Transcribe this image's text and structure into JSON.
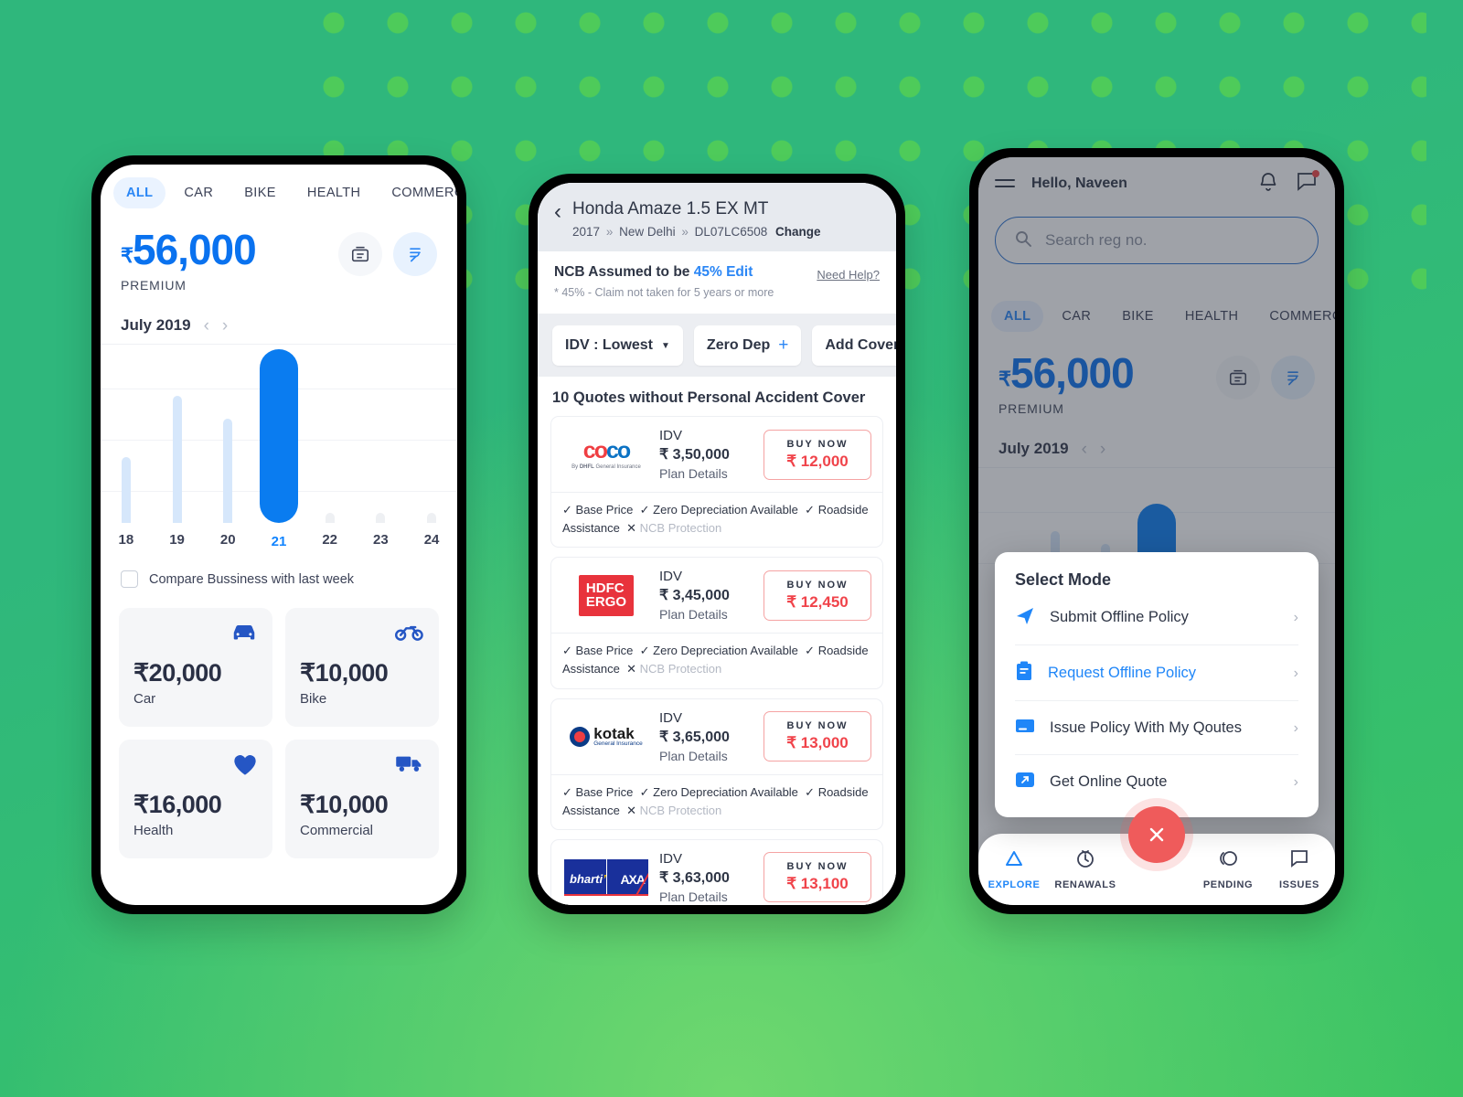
{
  "background": {
    "accent_green": "#2fb77c",
    "dot_color": "#4ecb5a"
  },
  "phone1": {
    "tabs": [
      {
        "label": "ALL",
        "active": true
      },
      {
        "label": "CAR",
        "active": false
      },
      {
        "label": "BIKE",
        "active": false
      },
      {
        "label": "HEALTH",
        "active": false
      },
      {
        "label": "COMMERCIAL",
        "active": false
      }
    ],
    "premium": {
      "currency": "₹",
      "amount": "56,000",
      "label": "PREMIUM"
    },
    "actions": [
      {
        "name": "statement-icon",
        "glyph": "▤"
      },
      {
        "name": "rupee-icon",
        "glyph": "₹"
      }
    ],
    "month": {
      "label": "July 2019",
      "prev": "‹",
      "next": "›"
    },
    "compare": {
      "label": "Compare Bussiness with last week",
      "checked": false
    },
    "cards": [
      {
        "icon": "car-icon",
        "amount": "₹20,000",
        "label": "Car"
      },
      {
        "icon": "bike-icon",
        "amount": "₹10,000",
        "label": "Bike"
      },
      {
        "icon": "heart-icon",
        "amount": "₹16,000",
        "label": "Health"
      },
      {
        "icon": "truck-icon",
        "amount": "₹10,000",
        "label": "Commercial"
      }
    ]
  },
  "chart_data": {
    "type": "bar",
    "title": "July 2019",
    "xlabel": "",
    "ylabel": "",
    "categories": [
      "18",
      "19",
      "20",
      "21",
      "22",
      "23",
      "24"
    ],
    "values": [
      38,
      73,
      60,
      100,
      6,
      6,
      6
    ],
    "ylim": [
      0,
      100
    ],
    "grid": true,
    "legend": null,
    "selected_index": 3,
    "selected_label": "21",
    "colors": {
      "bar": "#d6e7fb",
      "selected": "#0a7cf0",
      "empty": "#eef0f3"
    }
  },
  "phone2": {
    "header": {
      "back": "‹",
      "title": "Honda Amaze 1.5 EX MT",
      "year": "2017",
      "city": "New Delhi",
      "reg": "DL07LC6508",
      "change": "Change",
      "separator": "»"
    },
    "ncb": {
      "text_before": "NCB Assumed to be ",
      "percent": "45%",
      "edit": "Edit",
      "note": "* 45% - Claim not taken for 5 years or more",
      "need_help": "Need Help?"
    },
    "chips": [
      {
        "label": "IDV : Lowest",
        "trailing": "caret"
      },
      {
        "label": "Zero Dep",
        "trailing": "plus"
      },
      {
        "label": "Add Cover",
        "trailing": "plus"
      },
      {
        "label": "",
        "trailing": "none"
      }
    ],
    "quotes_heading": "10 Quotes without Personal Accident Cover",
    "feature_text": {
      "base": "Base Price",
      "zero_dep": "Zero Depreciation Available",
      "roadside": "Roadside Assistance",
      "ncb": "NCB Protection",
      "tick": "✓",
      "cross": "✕"
    },
    "quotes": [
      {
        "insurer": "coco",
        "insurer_sub": "By DHFL General Insurance",
        "idv_label": "IDV",
        "idv": "₹ 3,50,000",
        "plan_details": "Plan Details",
        "buy_label": "BUY NOW",
        "price": "₹ 12,000"
      },
      {
        "insurer": "hdfc-ergo",
        "insurer_sub": "",
        "idv_label": "IDV",
        "idv": "₹ 3,45,000",
        "plan_details": "Plan Details",
        "buy_label": "BUY NOW",
        "price": "₹ 12,450"
      },
      {
        "insurer": "kotak",
        "insurer_sub": "General Insurance",
        "idv_label": "IDV",
        "idv": "₹ 3,65,000",
        "plan_details": "Plan Details",
        "buy_label": "BUY NOW",
        "price": "₹ 13,000"
      },
      {
        "insurer": "bharti-axa",
        "insurer_sub": "",
        "idv_label": "IDV",
        "idv": "₹ 3,63,000",
        "plan_details": "Plan Details",
        "buy_label": "BUY NOW",
        "price": "₹ 13,100"
      }
    ]
  },
  "phone3": {
    "greeting": "Hello, Naveen",
    "search": {
      "placeholder": "Search reg no.",
      "value": ""
    },
    "tabs": [
      {
        "label": "ALL",
        "active": true
      },
      {
        "label": "CAR",
        "active": false
      },
      {
        "label": "BIKE",
        "active": false
      },
      {
        "label": "HEALTH",
        "active": false
      },
      {
        "label": "COMMERCIAL",
        "active": false
      }
    ],
    "premium": {
      "currency": "₹",
      "amount": "56,000",
      "label": "PREMIUM"
    },
    "month": {
      "label": "July 2019",
      "prev": "‹",
      "next": "›"
    },
    "modal": {
      "title": "Select Mode",
      "items": [
        {
          "icon": "send-icon",
          "label": "Submit Offline Policy",
          "active": false,
          "chevron": "›"
        },
        {
          "icon": "clipboard-icon",
          "label": "Request Offline Policy",
          "active": true,
          "chevron": "›"
        },
        {
          "icon": "card-icon",
          "label": "Issue Policy With My Qoutes",
          "active": false,
          "chevron": "›"
        },
        {
          "icon": "external-link-icon",
          "label": "Get Online Quote",
          "active": false,
          "chevron": "›"
        }
      ]
    },
    "bottom_nav": [
      {
        "icon": "explore-icon",
        "label": "EXPLORE",
        "active": true
      },
      {
        "icon": "renewals-icon",
        "label": "RENAWALS",
        "active": false
      },
      {
        "icon": "pending-icon",
        "label": "PENDING",
        "active": false
      },
      {
        "icon": "issues-icon",
        "label": "ISSUES",
        "active": false
      }
    ],
    "fab": {
      "name": "close-fab",
      "glyph": "✕",
      "color": "#ef5b5b"
    }
  }
}
